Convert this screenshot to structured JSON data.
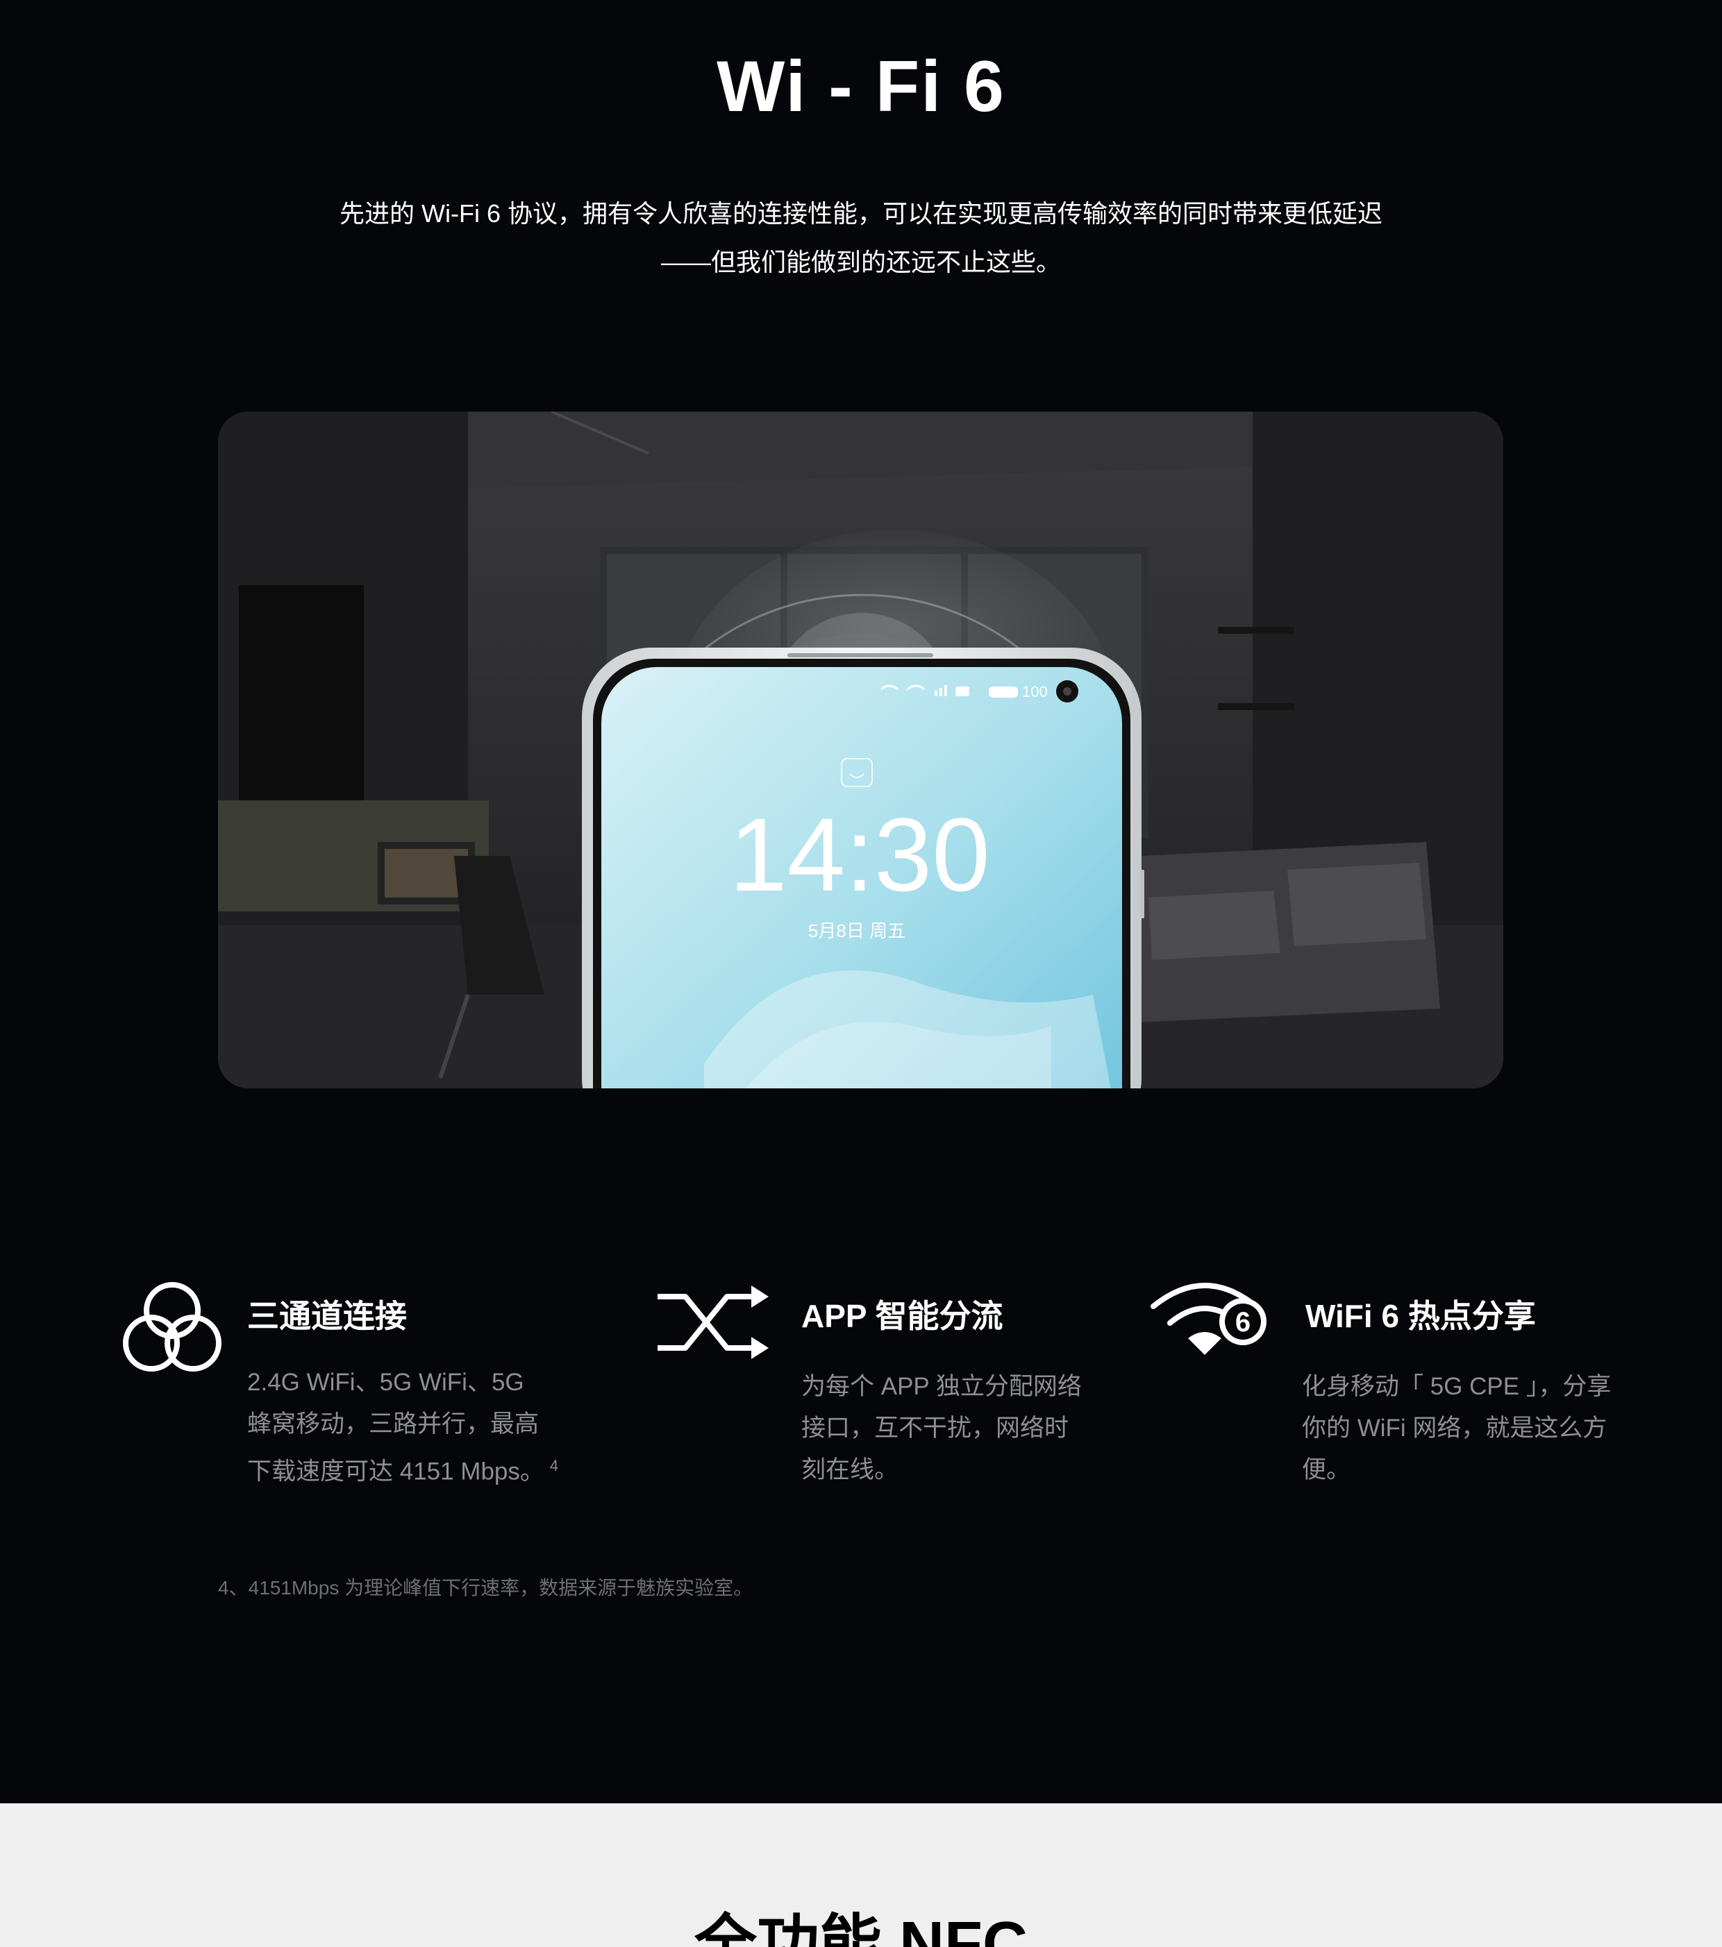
{
  "wifi_section": {
    "title": "Wi - Fi 6",
    "subtitle_line1": "先进的 Wi-Fi 6 协议，拥有令人欣喜的连接性能，可以在实现更高传输效率的同时带来更低延迟",
    "subtitle_line2": "——但我们能做到的还远不止这些。"
  },
  "phone_screen": {
    "time": "14:30",
    "date": "5月8日 周五",
    "battery": "100"
  },
  "features": [
    {
      "icon": "three-rings-icon",
      "title": "三通道连接",
      "lines": [
        "2.4G WiFi、5G WiFi、5G",
        "蜂窝移动，三路并行，最高",
        "下载速度可达 4151 Mbps。"
      ],
      "footnote_ref": "4"
    },
    {
      "icon": "shuffle-icon",
      "title": "APP 智能分流",
      "lines": [
        "为每个 APP 独立分配网络",
        "接口，互不干扰，网络时",
        "刻在线。"
      ]
    },
    {
      "icon": "wifi6-icon",
      "title": "WiFi 6 热点分享",
      "lines": [
        "化身移动「 5G CPE 」，分享",
        "你的 WiFi 网络，就是这么方",
        "便。"
      ]
    }
  ],
  "footnote": "4、4151Mbps 为理论峰值下行速率，数据来源于魅族实验室。",
  "next_section": {
    "title": "全功能 NFC"
  },
  "colors": {
    "dark_bg": "#05060a",
    "light_bg": "#efefef",
    "body_text": "#8e8e93",
    "footnote_text": "#6e6e73",
    "screen_blue": "#8fd3e6"
  }
}
